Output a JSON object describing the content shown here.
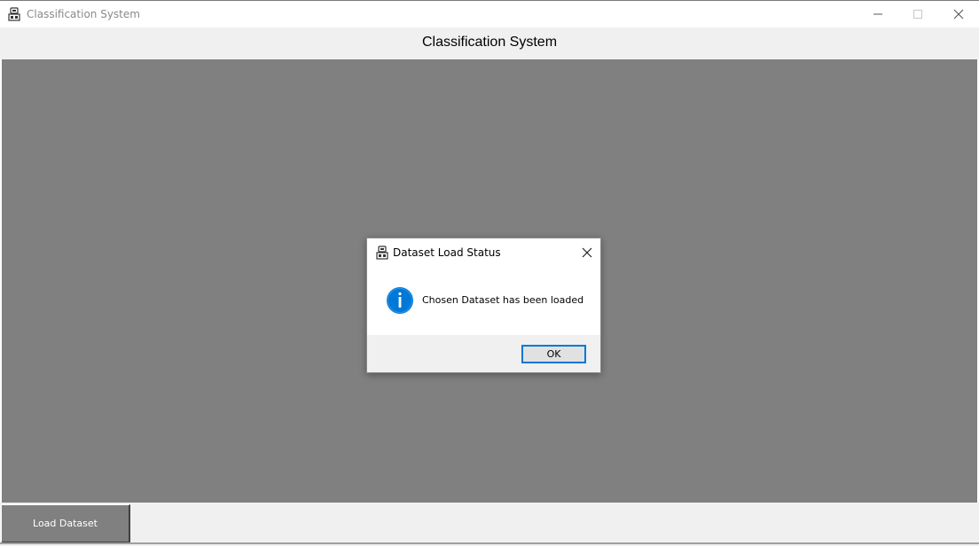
{
  "window": {
    "title": "Classification System",
    "icon": "app-icon"
  },
  "header": {
    "title": "Classification System"
  },
  "bottom": {
    "load_button_label": "Load Dataset"
  },
  "dialog": {
    "title": "Dataset Load Status",
    "message": "Chosen Dataset has been loaded",
    "ok_label": "OK",
    "icon": "info-icon",
    "accent_color": "#0078d7"
  },
  "colors": {
    "canvas": "#808080",
    "panel": "#f0f0f0"
  }
}
